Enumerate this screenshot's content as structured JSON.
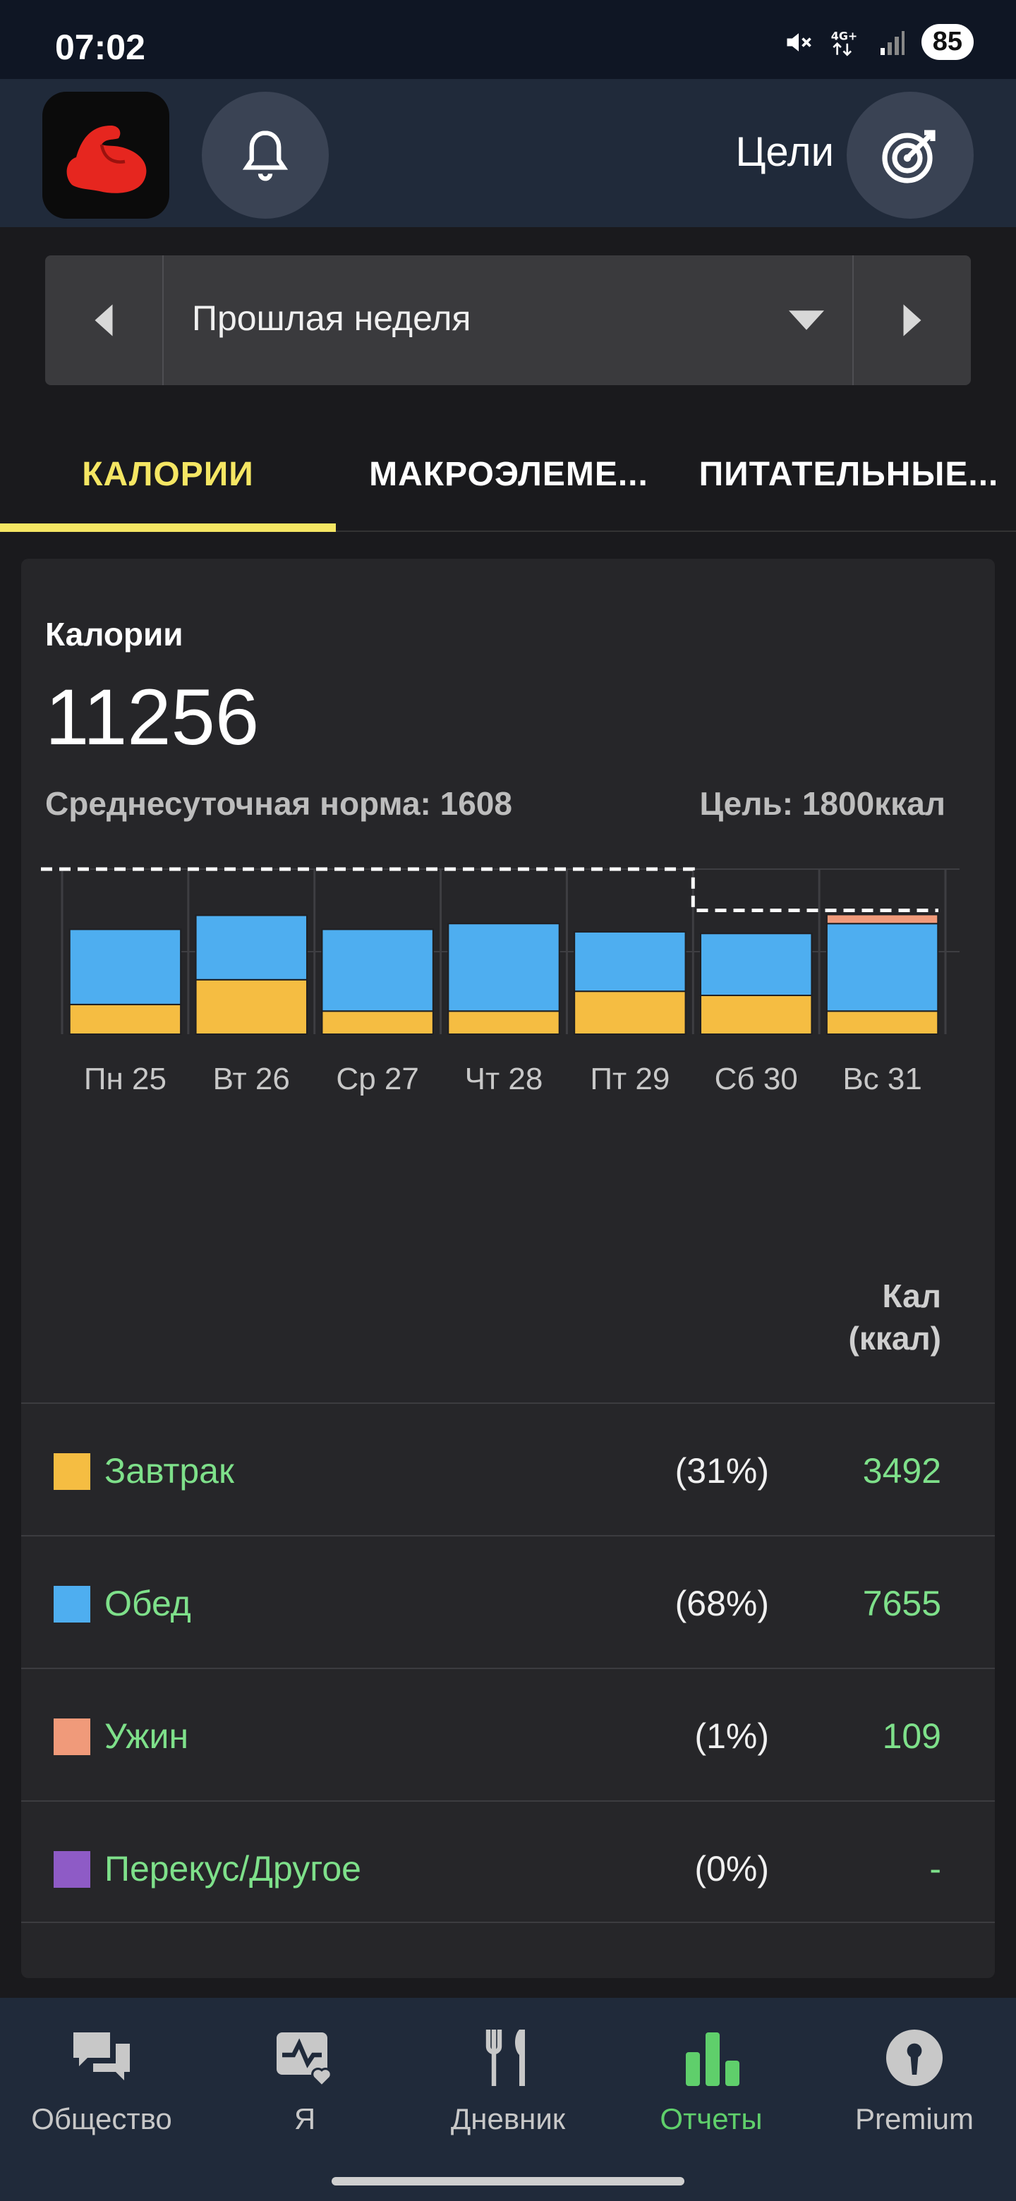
{
  "status_bar": {
    "time": "07:02",
    "battery": "85"
  },
  "header": {
    "goals_label": "Цели"
  },
  "period": {
    "label": "Прошлая неделя"
  },
  "tabs": [
    {
      "label": "КАЛОРИИ"
    },
    {
      "label": "МАКРОЭЛЕМЕ..."
    },
    {
      "label": "ПИТАТЕЛЬНЫЕ..."
    }
  ],
  "card": {
    "title": "Калории",
    "total": "11256",
    "average": "Среднесуточная норма: 1608",
    "goal": "Цель: 1800ккал",
    "column_header_line1": "Кал",
    "column_header_line2": "(ккал)"
  },
  "chart_data": {
    "type": "bar",
    "stacked": true,
    "categories": [
      "Пн 25",
      "Вт 26",
      "Ср 27",
      "Чт 28",
      "Пт 29",
      "Сб 30",
      "Вс 31"
    ],
    "series": [
      {
        "name": "Завтрак",
        "color": "#f5bd42",
        "values": [
          360,
          660,
          280,
          280,
          520,
          470,
          280
        ]
      },
      {
        "name": "Обед",
        "color": "#4eaef0",
        "values": [
          910,
          780,
          990,
          1060,
          720,
          750,
          1060
        ]
      },
      {
        "name": "Ужин",
        "color": "#f09a7a",
        "values": [
          0,
          0,
          0,
          0,
          0,
          0,
          109
        ]
      },
      {
        "name": "Перекус/Другое",
        "color": "#8e5bc6",
        "values": [
          0,
          0,
          0,
          0,
          0,
          0,
          0
        ]
      }
    ],
    "goal_line": [
      2000,
      2000,
      2000,
      2000,
      2000,
      1500,
      1500
    ],
    "ylim": [
      0,
      2000
    ],
    "grid": true
  },
  "meals": [
    {
      "name": "Завтрак",
      "pct": "(31%)",
      "value": "3492",
      "color": "#f5bd42"
    },
    {
      "name": "Обед",
      "pct": "(68%)",
      "value": "7655",
      "color": "#4eaef0"
    },
    {
      "name": "Ужин",
      "pct": "(1%)",
      "value": "109",
      "color": "#f09a7a"
    },
    {
      "name": "Перекус/Другое",
      "pct": "(0%)",
      "value": "-",
      "color": "#8e5bc6"
    }
  ],
  "nav": [
    {
      "label": "Общество",
      "icon": "community-icon"
    },
    {
      "label": "Я",
      "icon": "me-icon"
    },
    {
      "label": "Дневник",
      "icon": "diary-icon"
    },
    {
      "label": "Отчеты",
      "icon": "reports-icon",
      "active": true
    },
    {
      "label": "Premium",
      "icon": "premium-icon"
    }
  ]
}
